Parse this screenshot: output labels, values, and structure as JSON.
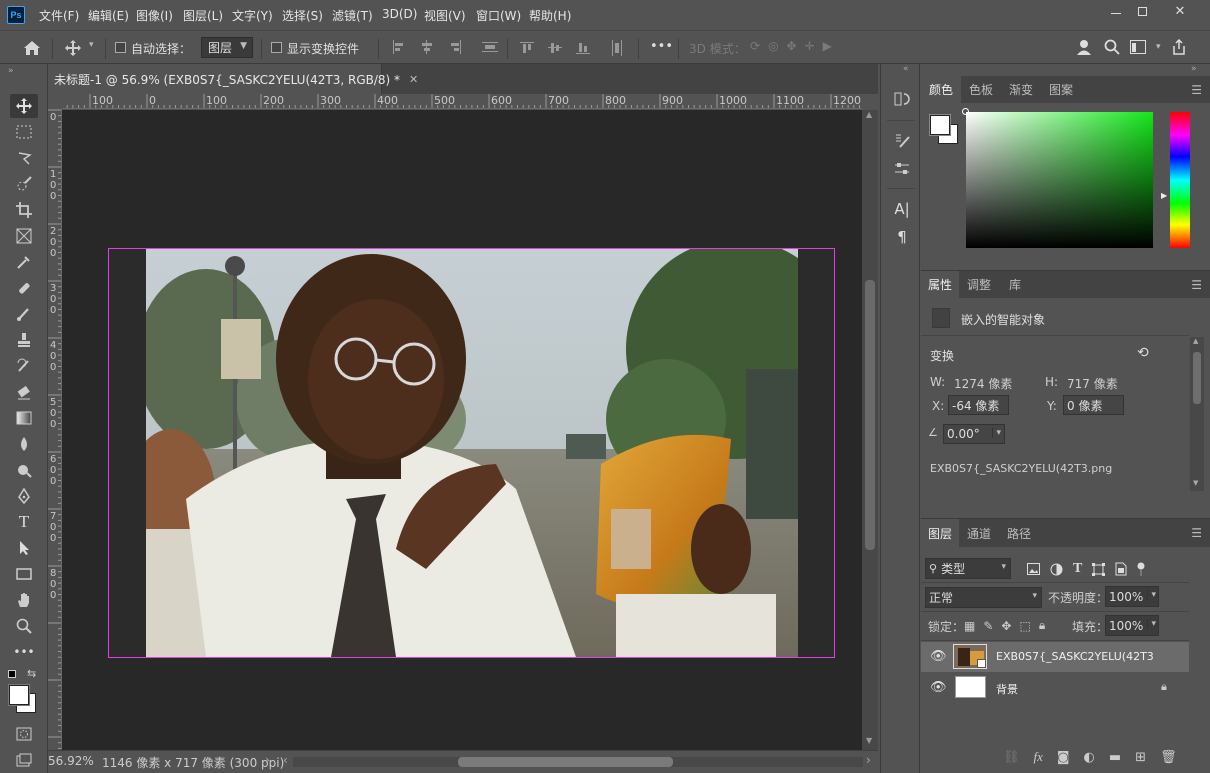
{
  "app": {
    "logo": "Ps"
  },
  "menu": [
    "文件(F)",
    "编辑(E)",
    "图像(I)",
    "图层(L)",
    "文字(Y)",
    "选择(S)",
    "滤镜(T)",
    "3D(D)",
    "视图(V)",
    "窗口(W)",
    "帮助(H)"
  ],
  "options": {
    "auto_select_label": "自动选择：",
    "auto_select_value": "图层",
    "show_transform_label": "显示变换控件",
    "more_label": "•••",
    "mode3d_label": "3D 模式："
  },
  "document": {
    "tab_title": "未标题-1 @ 56.9% (EXB0S7{_SASKC2YELU(42T3, RGB/8) *",
    "ruler_h": [
      "100",
      "0",
      "100",
      "200",
      "300",
      "400",
      "500",
      "600",
      "700",
      "800",
      "900",
      "1000",
      "1100",
      "1200"
    ],
    "ruler_v": [
      "0",
      "1 0 0",
      "2 0 0",
      "3 0 0",
      "4 0 0",
      "5 0 0",
      "6 0 0",
      "7 0 0",
      "8 0 0"
    ],
    "zoom": "56.92%",
    "dimensions": "1146 像素 x 717 像素 (300 ppi)"
  },
  "colors_panel": {
    "tabs": [
      "颜色",
      "色板",
      "渐变",
      "图案"
    ],
    "active_tab": "颜色"
  },
  "properties_panel": {
    "tabs": [
      "属性",
      "调整",
      "库"
    ],
    "active_tab": "属性",
    "object_type": "嵌入的智能对象",
    "transform_label": "变换",
    "w_label": "W:",
    "w_value": "1274 像素",
    "h_label": "H:",
    "h_value": "717 像素",
    "x_label": "X:",
    "x_value": "-64 像素",
    "y_label": "Y:",
    "y_value": "0 像素",
    "angle_value": "0.00°",
    "filename": "EXB0S7{_SASKC2YELU(42T3.png"
  },
  "layers_panel": {
    "tabs": [
      "图层",
      "通道",
      "路径"
    ],
    "active_tab": "图层",
    "filter_label": "类型",
    "blend_mode": "正常",
    "opacity_label": "不透明度：",
    "opacity_value": "100%",
    "lock_label": "锁定：",
    "fill_label": "填充：",
    "fill_value": "100%",
    "layers": [
      {
        "name": "EXB0S7{_SASKC2YELU(42T3",
        "selected": true
      },
      {
        "name": "背景",
        "selected": false
      }
    ]
  },
  "theme": {
    "selection_border": "#e040e0",
    "accent": "#31a8ff"
  }
}
